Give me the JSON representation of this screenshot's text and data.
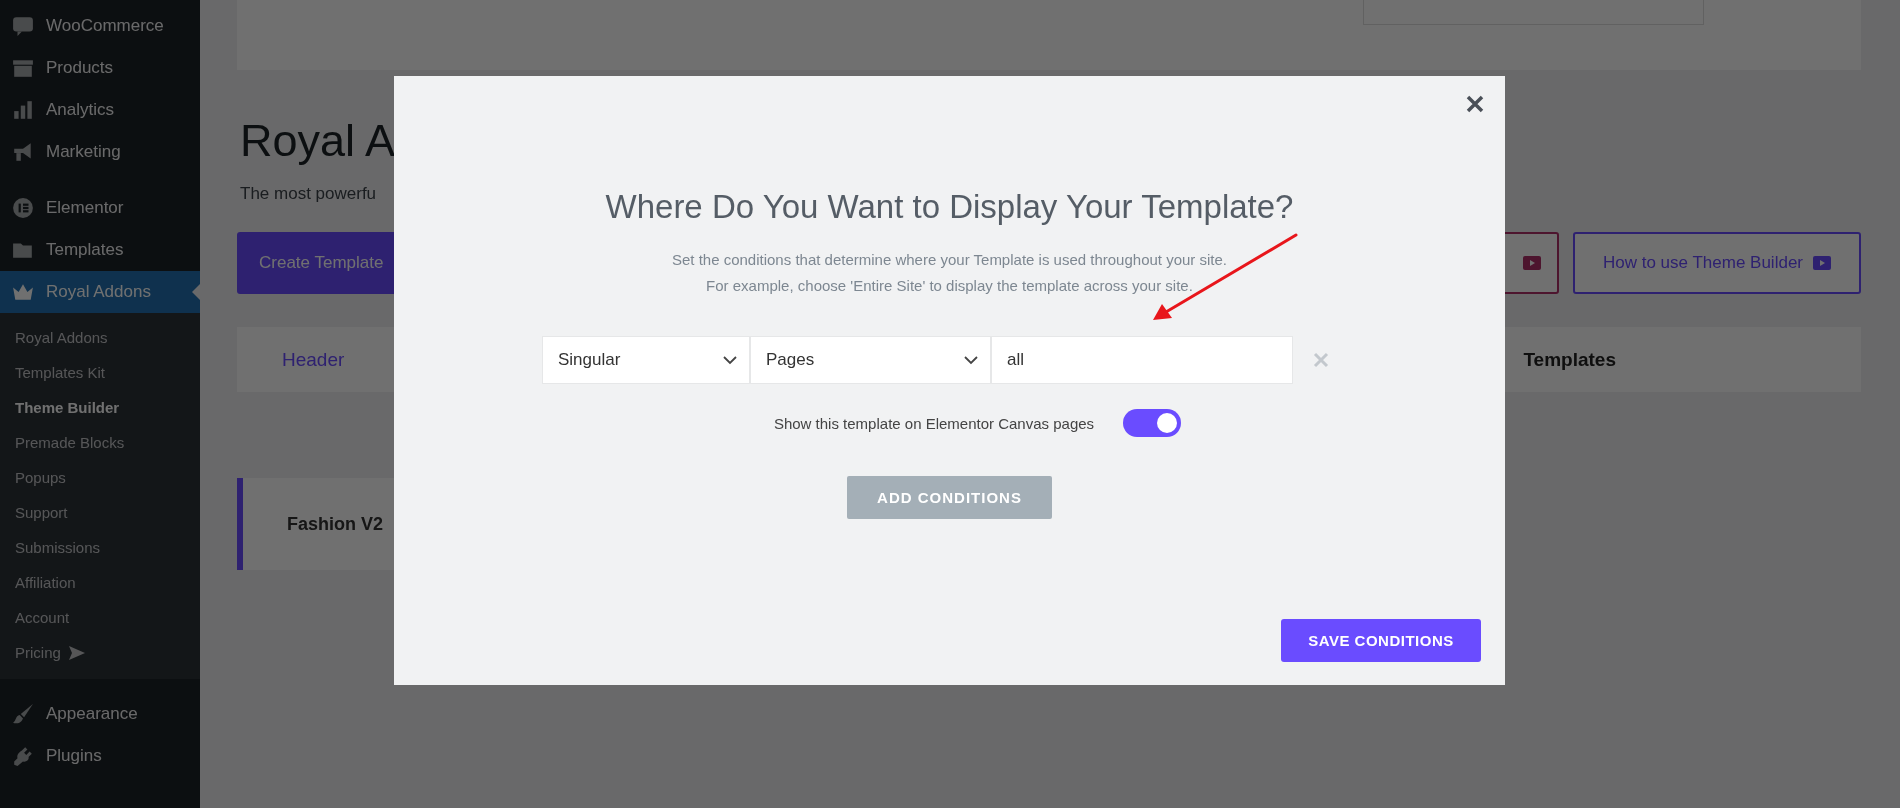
{
  "sidebar": {
    "groups": [
      {
        "items": [
          {
            "label": "WooCommerce",
            "selected": false
          },
          {
            "label": "Products",
            "selected": false
          },
          {
            "label": "Analytics",
            "selected": false
          },
          {
            "label": "Marketing",
            "selected": false
          }
        ]
      },
      {
        "items": [
          {
            "label": "Elementor",
            "selected": false
          },
          {
            "label": "Templates",
            "selected": false
          },
          {
            "label": "Royal Addons",
            "selected": true,
            "submenu": [
              {
                "label": "Royal Addons",
                "selected": false,
                "kind": "link"
              },
              {
                "label": "Templates Kit",
                "selected": false,
                "kind": "link"
              },
              {
                "label": "Theme Builder",
                "selected": true,
                "kind": "link"
              },
              {
                "label": "Premade Blocks",
                "selected": false,
                "kind": "link"
              },
              {
                "label": "Popups",
                "selected": false,
                "kind": "link"
              },
              {
                "label": "Support",
                "selected": false,
                "kind": "link"
              },
              {
                "label": "Submissions",
                "selected": false,
                "kind": "link"
              },
              {
                "label": "Affiliation",
                "selected": false,
                "kind": "link"
              },
              {
                "label": "Account",
                "selected": false,
                "kind": "link"
              },
              {
                "label": "Pricing",
                "selected": false,
                "kind": "upgrade"
              }
            ]
          }
        ]
      },
      {
        "items": [
          {
            "label": "Appearance",
            "selected": false
          },
          {
            "label": "Plugins",
            "selected": false
          }
        ]
      }
    ]
  },
  "page": {
    "heading": "Royal A",
    "subtitle": "The most powerfu",
    "create_button": "Create Template",
    "help_button": "How to use Theme Builder",
    "tabs": [
      {
        "label": "Header",
        "selected": true
      },
      {
        "label": "Templates",
        "selected": false
      }
    ],
    "template_card": {
      "title": "Fashion V2"
    }
  },
  "modal": {
    "title": "Where Do You Want to Display Your Template?",
    "description": [
      "Set the conditions that determine where your Template is used throughout your site.",
      "For example, choose 'Entire Site' to display the template across your site."
    ],
    "condition_fields": [
      {
        "kind": "select",
        "value": "Singular"
      },
      {
        "kind": "select",
        "value": "Pages"
      },
      {
        "kind": "input",
        "value": "all"
      }
    ],
    "canvas_toggle": {
      "label": "Show this template on Elementor Canvas pages",
      "on": true
    },
    "add_button": "ADD CONDITIONS",
    "save_button": "SAVE CONDITIONS"
  }
}
